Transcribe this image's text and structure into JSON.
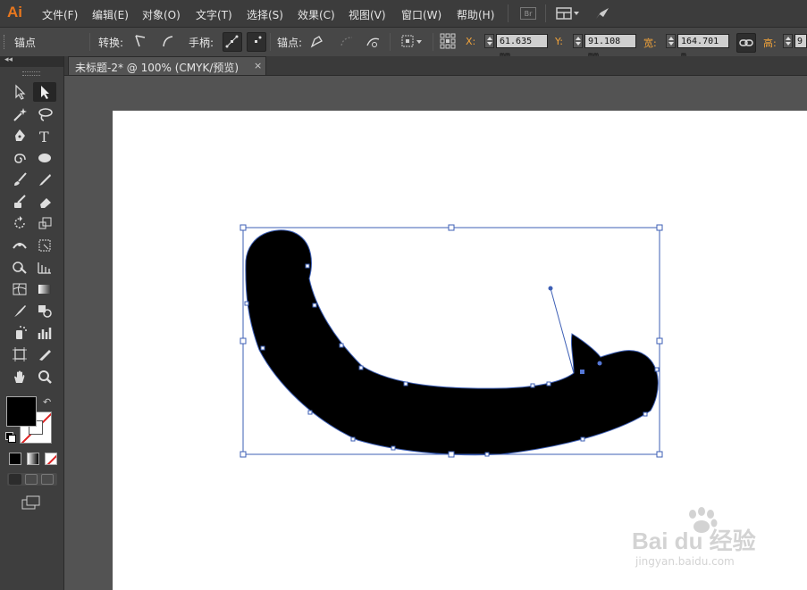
{
  "app": {
    "logo": "Ai",
    "menus": [
      "文件(F)",
      "编辑(E)",
      "对象(O)",
      "文字(T)",
      "选择(S)",
      "效果(C)",
      "视图(V)",
      "窗口(W)",
      "帮助(H)"
    ],
    "bridge_label": "Br"
  },
  "control_bar": {
    "anchor_label": "锚点",
    "convert_label": "转换:",
    "handle_label": "手柄:",
    "anchor_points_label": "锚点:",
    "x_label": "X:",
    "x_value": "61.635 mm",
    "y_label": "Y:",
    "y_value": "91.108 mm",
    "width_label": "宽:",
    "width_value": "164.701 m",
    "height_label": "高:",
    "height_value": "9"
  },
  "document_tab": {
    "title": "未标题-2* @ 100% (CMYK/预览)",
    "close": "×"
  },
  "colors": {
    "menubar": "#3c3c3c",
    "control_bar": "#474747",
    "panel": "#3e3e3e",
    "canvas": "#535353",
    "artboard": "#ffffff",
    "accent_orange": "#e8771e",
    "selection_blue": "#3d5fb5",
    "fill": "#000000"
  },
  "tools": [
    "selection-tool",
    "direct-selection-tool",
    "magic-wand-tool",
    "lasso-tool",
    "pen-tool",
    "type-tool",
    "spiral-tool",
    "ellipse-tool",
    "paintbrush-tool",
    "pencil-tool",
    "blob-brush-tool",
    "eraser-tool",
    "rotate-tool",
    "scale-tool",
    "width-tool",
    "free-transform-tool",
    "shape-builder-tool",
    "perspective-grid-tool",
    "mesh-tool",
    "gradient-tool",
    "eyedropper-tool",
    "blend-tool",
    "symbol-sprayer-tool",
    "column-graph-tool",
    "artboard-tool",
    "slice-tool",
    "hand-tool",
    "zoom-tool"
  ],
  "watermark": {
    "brand": "Bai du 经验",
    "url": "jingyan.baidu.com"
  }
}
